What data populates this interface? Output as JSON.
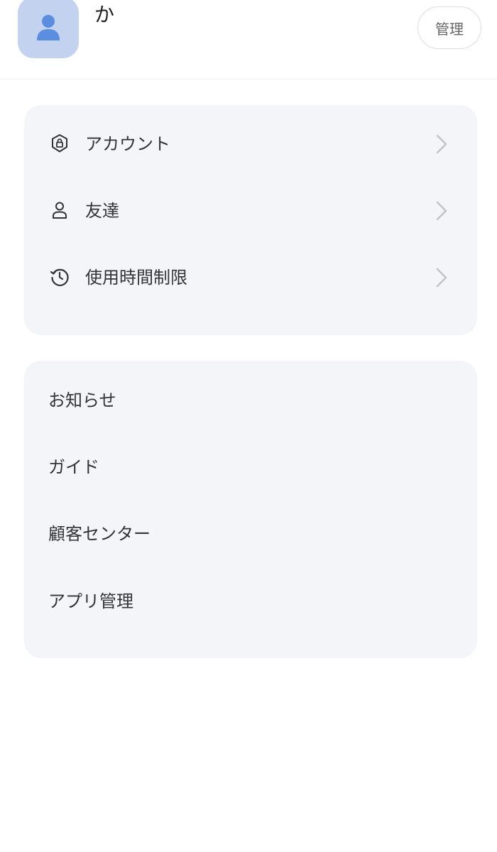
{
  "profile": {
    "name": "か",
    "manage_label": "管理"
  },
  "menu_primary": [
    {
      "label": "アカウント",
      "icon": "shield-lock-icon"
    },
    {
      "label": "友達",
      "icon": "person-icon"
    },
    {
      "label": "使用時間制限",
      "icon": "clock-history-icon"
    }
  ],
  "menu_secondary": [
    {
      "label": "お知らせ"
    },
    {
      "label": "ガイド"
    },
    {
      "label": "顧客センター"
    },
    {
      "label": "アプリ管理"
    }
  ],
  "colors": {
    "avatar_bg": "#c3d3ef",
    "avatar_icon": "#5b8de0",
    "card_bg": "#f4f5f9",
    "chevron": "#c2c4ca"
  }
}
